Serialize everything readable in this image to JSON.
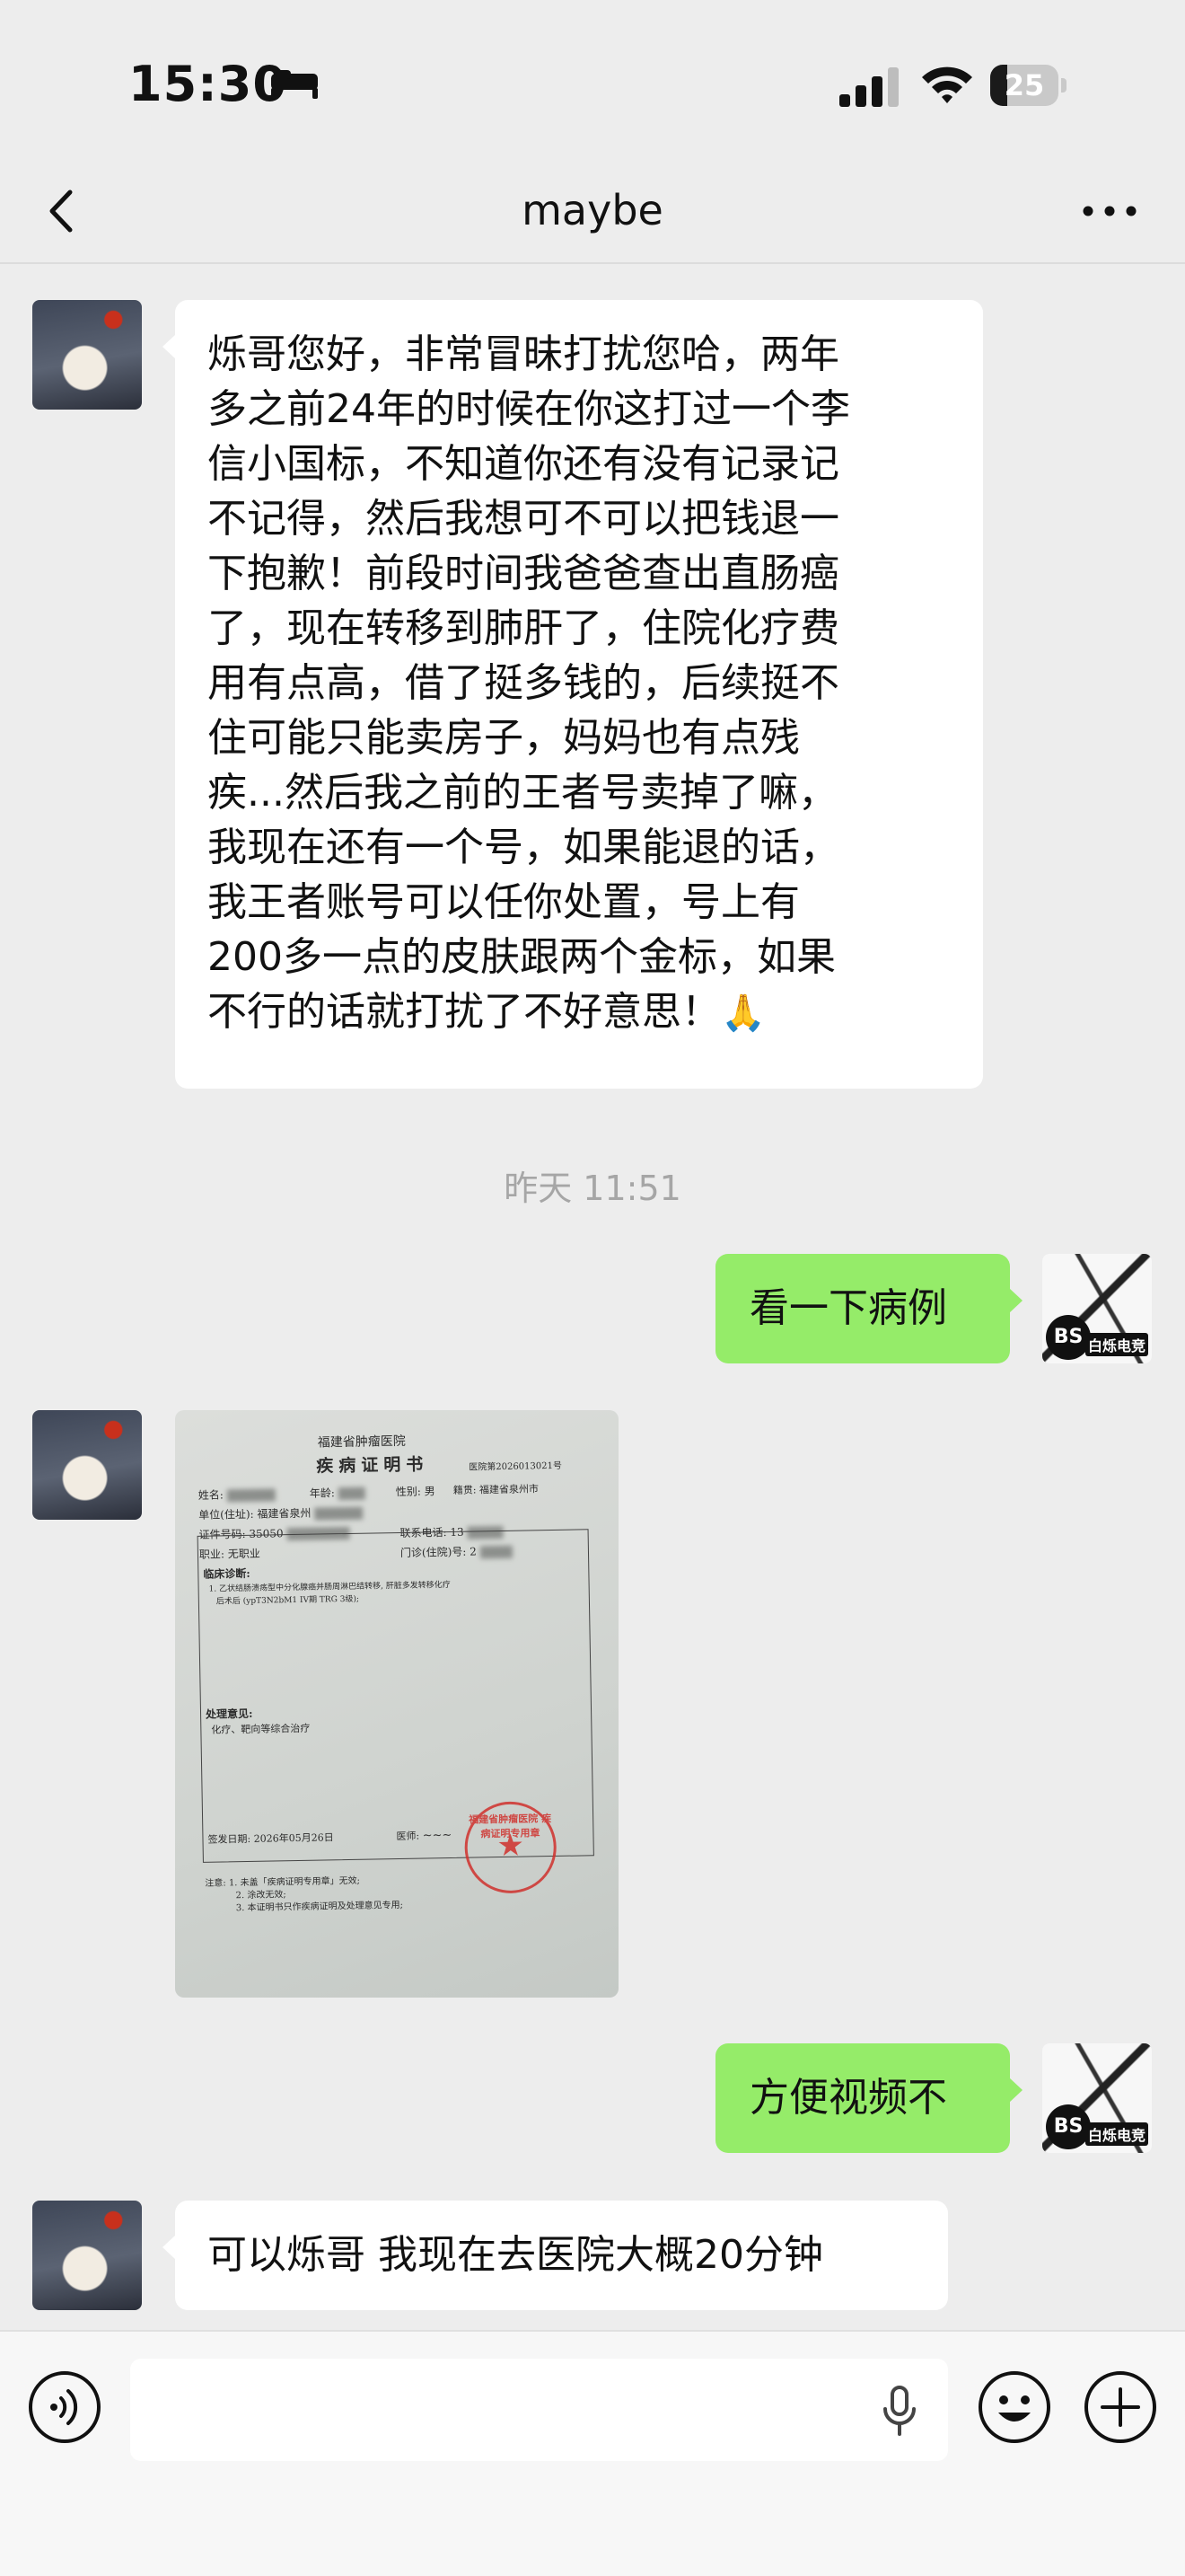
{
  "status_bar": {
    "time": "15:30",
    "battery_level": "25",
    "battery_fraction": 0.25,
    "icons": [
      "bed-icon",
      "cellular-signal-icon",
      "wifi-icon",
      "battery-icon"
    ]
  },
  "nav": {
    "title": "maybe",
    "back_icon": "chevron-left-icon",
    "more_icon": "more-dots-icon"
  },
  "messages": [
    {
      "side": "left",
      "type": "text",
      "lines": [
        "烁哥您好，非常冒昧打扰您哈，两年",
        "多之前24年的时候在你这打过一个李",
        "信小国标，不知道你还有没有记录记",
        "不记得，然后我想可不可以把钱退一",
        "下抱歉！前段时间我爸爸查出直肠癌",
        "了，现在转移到肺肝了，住院化疗费",
        "用有点高，借了挺多钱的，后续挺不",
        "住可能只能卖房子，妈妈也有点残",
        "疾...然后我之前的王者号卖掉了嘛，",
        "我现在还有一个号，如果能退的话，",
        "我王者账号可以任你处置，号上有",
        "200多一点的皮肤跟两个金标，如果",
        "不行的话就打扰了不好意思！"
      ],
      "emoji": "🙏"
    },
    {
      "type": "timestamp",
      "text": "昨天 11:51"
    },
    {
      "side": "right",
      "type": "text",
      "text": "看一下病例"
    },
    {
      "side": "left",
      "type": "image",
      "image": {
        "hospital": "福建省肿瘤医院",
        "title": "疾病证明书",
        "doc_no": "医院第2026013021号",
        "name_label": "姓名:",
        "age_label": "年龄:",
        "gender_label": "性别: 男",
        "origin_label": "籍贯: 福建省泉州市",
        "unit_label": "单位(住址): 福建省泉州",
        "id_label": "证件号码: 35050",
        "phone_label": "联系电话: 13",
        "job_label": "职业: 无职业",
        "clinic_label": "门诊(住院)号: 2",
        "diagnosis_label": "临床诊断:",
        "diagnosis_1": "1. 乙状结肠溃疡型中分化腺癌并肠周淋巴结转移, 肝脏多发转移化疗",
        "diagnosis_2": "后术后 (ypT3N2bM1 IV期 TRG 3级);",
        "opinion_label": "处理意见:",
        "opinion_text": "化疗、靶向等综合治疗",
        "date_label": "签发日期: 2026年05月26日",
        "doctor_label": "医师:",
        "note_1": "注意: 1. 未盖「疾病证明专用章」无效;",
        "note_2": "2. 涂改无效;",
        "note_3": "3. 本证明书只作疾病证明及处理意见专用;",
        "stamp_text": "福建省肿瘤医院 疾病证明专用章"
      }
    },
    {
      "side": "right",
      "type": "text",
      "text": "方便视频不"
    },
    {
      "side": "left",
      "type": "text",
      "text": "可以烁哥 我现在去医院大概20分钟"
    }
  ],
  "avatars": {
    "right_badge": "BS",
    "right_tag": "白烁电竞"
  },
  "input_bar": {
    "placeholder": "",
    "icons": [
      "voice-icon",
      "mic-icon",
      "emoji-icon",
      "plus-icon"
    ]
  },
  "colors": {
    "background": "#ededed",
    "bubble_out": "#95ec69",
    "bubble_in": "#ffffff",
    "timestamp": "#a6a6a6"
  }
}
